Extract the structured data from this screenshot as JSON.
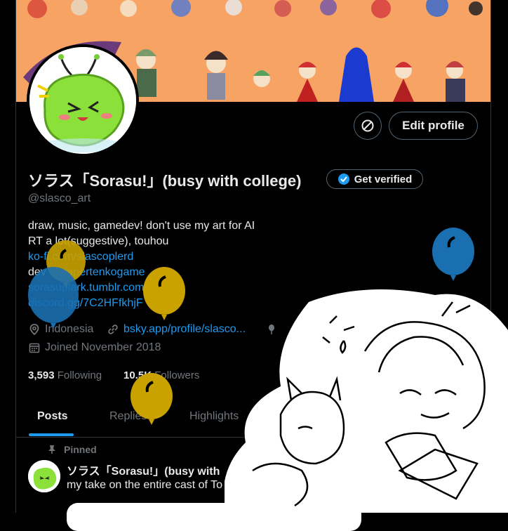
{
  "profile": {
    "display_name": "ソラス「Sorasu!」(busy with college)",
    "handle": "@slasco_art",
    "verify_label": "Get verified",
    "edit_label": "Edit profile",
    "bio_lines": [
      "draw, music, gamedev! don't use my art for AI",
      "RT a lot(suggestive), touhou"
    ],
    "links": {
      "kofi": "ko-fi.com/slascoplerd",
      "dev_prefix": "dev ",
      "dev_handle": "@papertenkogame",
      "tumblr": "sorasuplark.tumblr.com",
      "discord": "discord.gg/7C2HFfkhjF"
    },
    "location": "Indonesia",
    "website": "bsky.app/profile/slasco...",
    "joined": "Joined November 2018",
    "following_count": "3,593",
    "following_label": "Following",
    "followers_count": "10.5K",
    "followers_label": "Followers"
  },
  "tabs": [
    {
      "label": "Posts",
      "active": true
    },
    {
      "label": "Replies",
      "active": false
    },
    {
      "label": "Highlights",
      "active": false
    }
  ],
  "pinned_post": {
    "pinned_label": "Pinned",
    "author": "ソラス「Sorasu!」(busy with",
    "text": "my take on the entire cast of To"
  },
  "colors": {
    "accent": "#1d9bf0",
    "banner": "#f6a364",
    "balloon_gold": "#c9a200",
    "balloon_blue": "#1a6fb0"
  },
  "icons": [
    "sync-icon",
    "verified-badge-icon",
    "location-icon",
    "link-icon",
    "calendar-icon",
    "pin-icon",
    "birthday-icon"
  ]
}
